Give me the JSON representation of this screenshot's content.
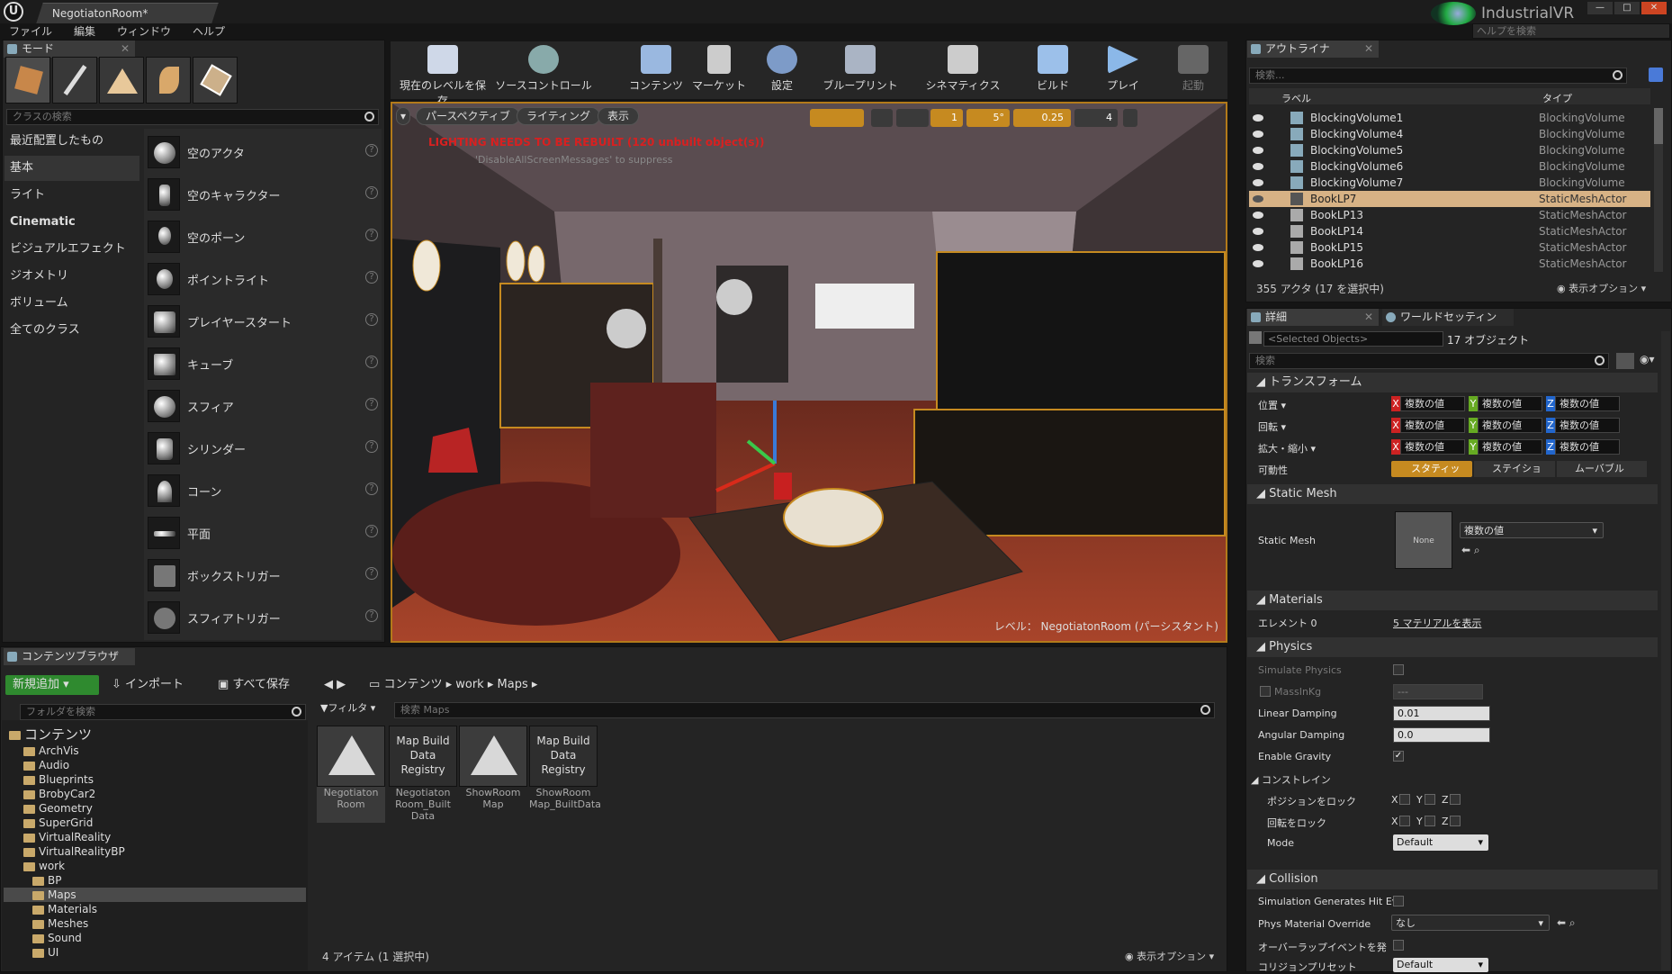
{
  "app": {
    "title": "NegotiatonRoom*",
    "brand": "IndustrialVR",
    "help_placeholder": "ヘルプを検索"
  },
  "menu": [
    "ファイル",
    "編集",
    "ウィンドウ",
    "ヘルプ"
  ],
  "modes": {
    "tab": "モード",
    "search_placeholder": "クラスの検索",
    "categories": [
      "最近配置したもの",
      "基本",
      "ライト",
      "Cinematic",
      "ビジュアルエフェクト",
      "ジオメトリ",
      "ボリューム",
      "全てのクラス"
    ],
    "items": [
      "空のアクタ",
      "空のキャラクター",
      "空のポーン",
      "ポイントライト",
      "プレイヤースタート",
      "キューブ",
      "スフィア",
      "シリンダー",
      "コーン",
      "平面",
      "ボックストリガー",
      "スフィアトリガー"
    ]
  },
  "toolbar": [
    "現在のレベルを保存",
    "ソースコントロール",
    "コンテンツ",
    "マーケット",
    "設定",
    "ブループリント",
    "シネマティクス",
    "ビルド",
    "プレイ",
    "起動"
  ],
  "viewport": {
    "perspective": "パースペクティブ",
    "lighting": "ライティング",
    "show": "表示",
    "warning": "LIGHTING NEEDS TO BE REBUILT (120 unbuilt object(s))",
    "hint": "'DisableAllScreenMessages' to suppress",
    "level": "レベル： NegotiatonRoom (パーシスタント)",
    "grid": "1",
    "angle": "5°",
    "scale": "0.25",
    "speed": "4"
  },
  "content": {
    "tab": "コンテンツブラウザ",
    "add_new": "新規追加",
    "import": "インポート",
    "save_all": "すべて保存",
    "path": [
      "コンテンツ",
      "work",
      "Maps"
    ],
    "folder_search": "フォルダを検索",
    "filter": "フィルタ",
    "asset_search": "検索 Maps",
    "tree": [
      {
        "name": "コンテンツ",
        "level": 0
      },
      {
        "name": "ArchVis",
        "level": 1
      },
      {
        "name": "Audio",
        "level": 1
      },
      {
        "name": "Blueprints",
        "level": 1
      },
      {
        "name": "BrobyCar2",
        "level": 1
      },
      {
        "name": "Geometry",
        "level": 1
      },
      {
        "name": "SuperGrid",
        "level": 1
      },
      {
        "name": "VirtualReality",
        "level": 1
      },
      {
        "name": "VirtualRealityBP",
        "level": 1
      },
      {
        "name": "work",
        "level": 1
      },
      {
        "name": "BP",
        "level": 2
      },
      {
        "name": "Maps",
        "level": 2
      },
      {
        "name": "Materials",
        "level": 2
      },
      {
        "name": "Meshes",
        "level": 2
      },
      {
        "name": "Sound",
        "level": 2
      },
      {
        "name": "UI",
        "level": 2
      }
    ],
    "assets": [
      {
        "name": "Negotiaton Room",
        "thumb": ""
      },
      {
        "name": "Negotiaton Room_Built Data",
        "thumb": "Map Build Data Registry"
      },
      {
        "name": "ShowRoom Map",
        "thumb": ""
      },
      {
        "name": "ShowRoom Map_BuiltData",
        "thumb": "Map Build Data Registry"
      }
    ],
    "status": "4 アイテム (1 選択中)",
    "view_options": "表示オプション"
  },
  "outliner": {
    "tab": "アウトライナ",
    "search_placeholder": "検索...",
    "col_label": "ラベル",
    "col_type": "タイプ",
    "rows": [
      {
        "name": "BlockingVolume1",
        "type": "BlockingVolume"
      },
      {
        "name": "BlockingVolume4",
        "type": "BlockingVolume"
      },
      {
        "name": "BlockingVolume5",
        "type": "BlockingVolume"
      },
      {
        "name": "BlockingVolume6",
        "type": "BlockingVolume"
      },
      {
        "name": "BlockingVolume7",
        "type": "BlockingVolume"
      },
      {
        "name": "BookLP7",
        "type": "StaticMeshActor"
      },
      {
        "name": "BookLP13",
        "type": "StaticMeshActor"
      },
      {
        "name": "BookLP14",
        "type": "StaticMeshActor"
      },
      {
        "name": "BookLP15",
        "type": "StaticMeshActor"
      },
      {
        "name": "BookLP16",
        "type": "StaticMeshActor"
      }
    ],
    "status": "355 アクタ (17 を選択中)",
    "view_options": "表示オプション"
  },
  "details": {
    "tab": "詳細",
    "tab2": "ワールドセッティン",
    "selected": "<Selected Objects>",
    "count": "17 オブジェクト",
    "search": "検索",
    "transform": "トランスフォーム",
    "location": "位置",
    "rotation": "回転",
    "scale": "拡大・縮小",
    "multi": "複数の値",
    "mobility": "可動性",
    "static": "スタティッ",
    "stationary": "ステイショ",
    "movable": "ムーバブル",
    "static_mesh_sec": "Static Mesh",
    "static_mesh": "Static Mesh",
    "none": "None",
    "materials": "Materials",
    "element": "エレメント 0",
    "show_mats": "5 マテリアルを表示",
    "physics": "Physics",
    "simulate": "Simulate Physics",
    "mass": "MassInKg",
    "mass_val": "---",
    "lin_damp": "Linear Damping",
    "lin_val": "0.01",
    "ang_damp": "Angular Damping",
    "ang_val": "0.0",
    "gravity": "Enable Gravity",
    "constraints": "コンストレイン",
    "lock_pos": "ポジションをロック",
    "lock_rot": "回転をロック",
    "mode": "Mode",
    "mode_val": "Default",
    "collision": "Collision",
    "sim_hit": "Simulation Generates Hit Ev",
    "phys_mat": "Phys Material Override",
    "phys_val": "なし",
    "overlap": "オーバーラップイベントを発",
    "preset": "コリジョンプリセット",
    "preset_val": "Default"
  },
  "colors": {
    "accent": "#c68a20",
    "selected_row": "#d7b285",
    "add_button": "#2f8a2f"
  }
}
